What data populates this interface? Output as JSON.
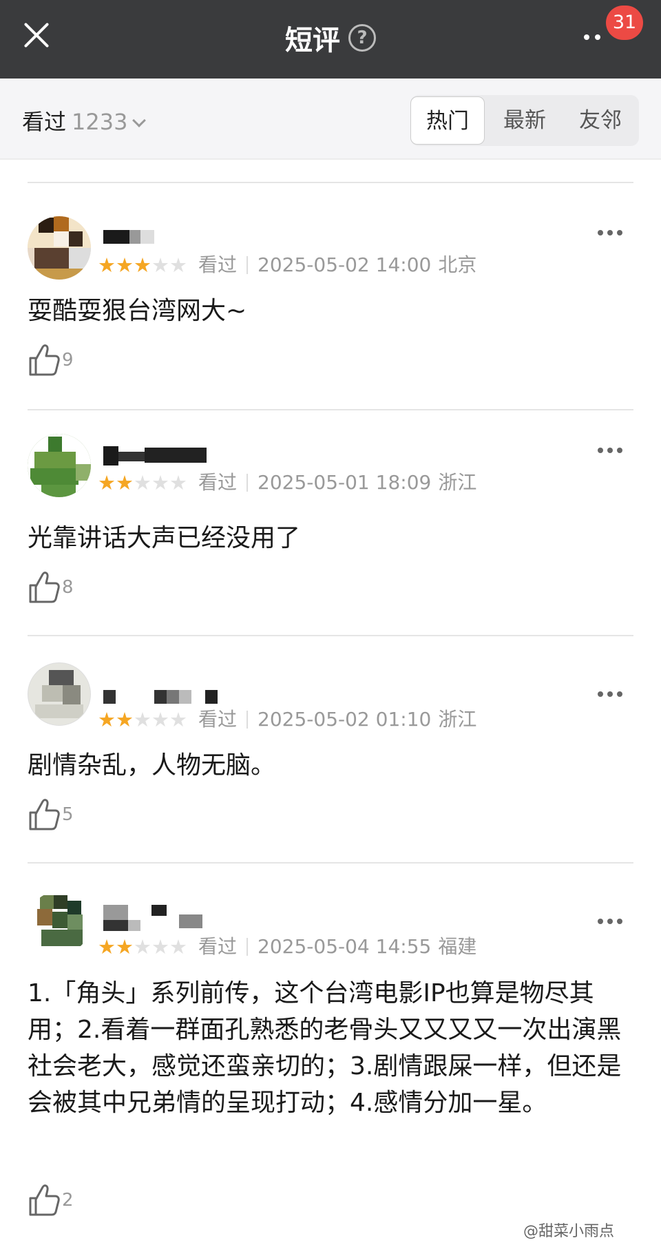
{
  "header": {
    "title": "短评",
    "help_icon": "?",
    "notification_count": "31"
  },
  "filter": {
    "seen_label": "看过",
    "seen_count": "1233",
    "tabs": [
      {
        "label": "热门",
        "active": true
      },
      {
        "label": "最新",
        "active": false
      },
      {
        "label": "友邻",
        "active": false
      }
    ]
  },
  "comments": [
    {
      "stars_filled": 3,
      "stars_total": 5,
      "status": "看过",
      "time": "2025-05-02 14:00",
      "location": "北京",
      "text": "耍酷耍狠台湾网大~",
      "likes": "9"
    },
    {
      "stars_filled": 2,
      "stars_total": 5,
      "status": "看过",
      "time": "2025-05-01 18:09",
      "location": "浙江",
      "text": "光靠讲话大声已经没用了",
      "likes": "8"
    },
    {
      "stars_filled": 2,
      "stars_total": 5,
      "status": "看过",
      "time": "2025-05-02 01:10",
      "location": "浙江",
      "text": "剧情杂乱，人物无脑。",
      "likes": "5"
    },
    {
      "stars_filled": 2,
      "stars_total": 5,
      "status": "看过",
      "time": "2025-05-04 14:55",
      "location": "福建",
      "text": "1.「角头」系列前传，这个台湾电影IP也算是物尽其用；2.看着一群面孔熟悉的老骨头又又又又一次出演黑社会老大，感觉还蛮亲切的；3.剧情跟屎一样，但还是会被其中兄弟情的呈现打动；4.感情分加一星。",
      "likes": "2"
    }
  ],
  "watermark": "@甜菜小雨点",
  "colors": {
    "header_bg": "#3a3b3d",
    "badge": "#ec4a44",
    "star_on": "#f5a623",
    "star_off": "#e0e0e0"
  }
}
